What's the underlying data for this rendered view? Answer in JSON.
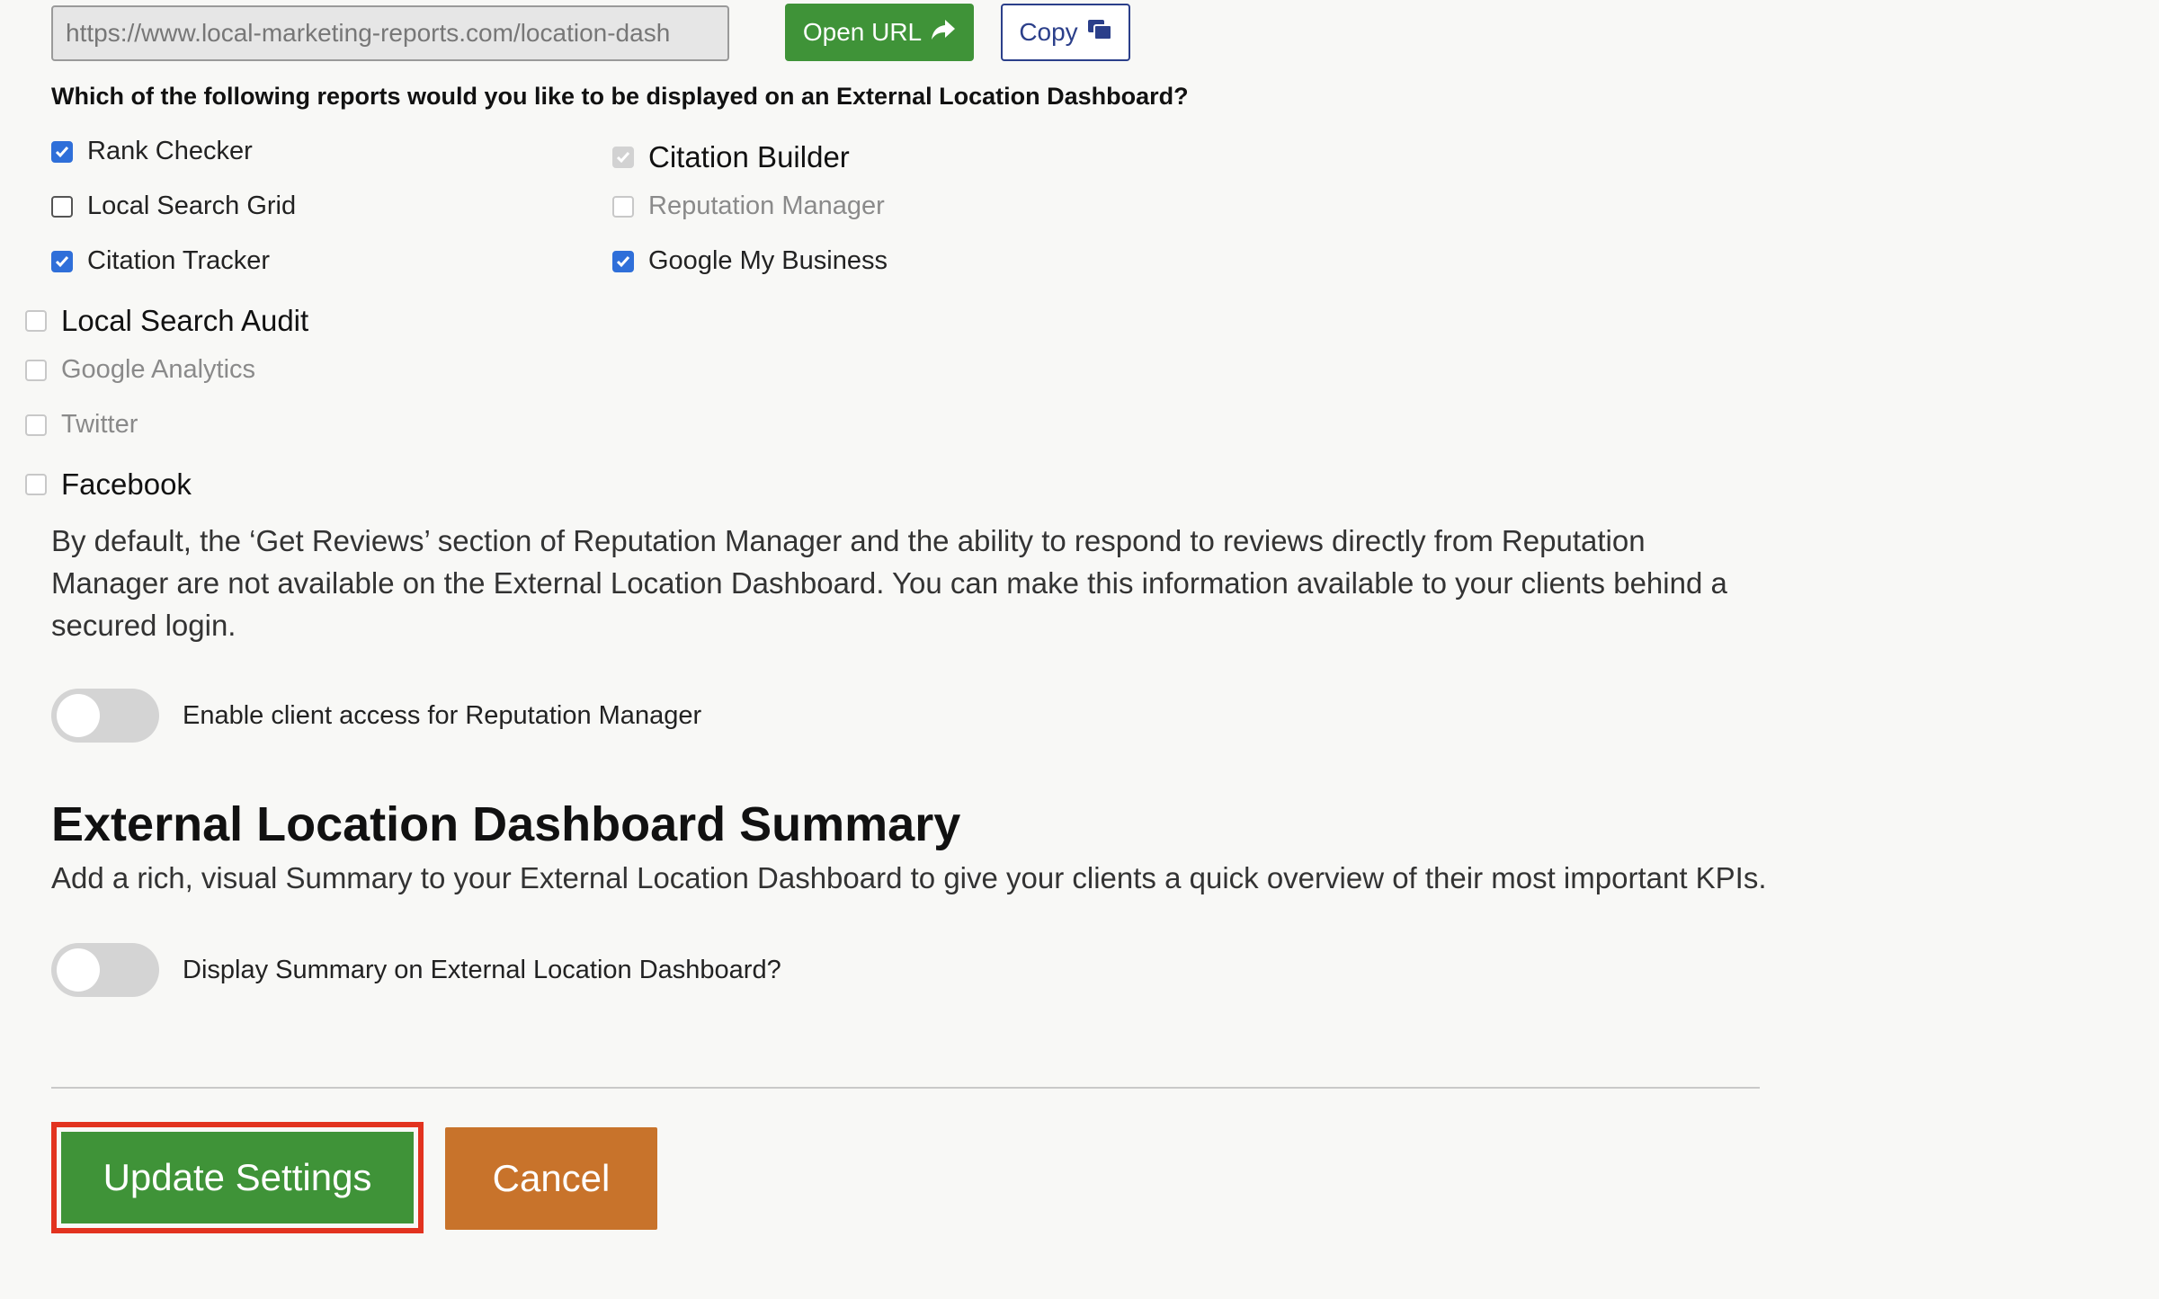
{
  "url_bar": {
    "value": "https://www.local-marketing-reports.com/location-dash",
    "open_label": "Open URL",
    "copy_label": "Copy"
  },
  "reports": {
    "question": "Which of the following reports would you like to be displayed on an External Location Dashboard?",
    "options": [
      {
        "label": "Rank Checker",
        "checked": true,
        "disabled": false
      },
      {
        "label": "Local Search Grid",
        "checked": false,
        "disabled": false
      },
      {
        "label": "Citation Tracker",
        "checked": true,
        "disabled": false
      },
      {
        "label": "Citation Builder",
        "checked": true,
        "disabled": true
      },
      {
        "label": "Reputation Manager",
        "checked": false,
        "disabled": true
      },
      {
        "label": "Google My Business",
        "checked": true,
        "disabled": false
      },
      {
        "label": "Local Search Audit",
        "checked": false,
        "disabled": false
      },
      {
        "label": "Google Analytics",
        "checked": false,
        "disabled": true
      },
      {
        "label": "Twitter",
        "checked": false,
        "disabled": true
      },
      {
        "label": "Facebook",
        "checked": false,
        "disabled": false
      }
    ]
  },
  "reputation_note": "By default, the ‘Get Reviews’ section of Reputation Manager and the ability to respond to reviews directly from Reputation Manager are not available on the External Location Dashboard. You can make this information available to your clients behind a secured login.",
  "toggles": {
    "client_access": {
      "label": "Enable client access for Reputation Manager",
      "on": false
    },
    "display_summary": {
      "label": "Display Summary on External Location Dashboard?",
      "on": false
    }
  },
  "summary": {
    "title": "External Location Dashboard Summary",
    "description": "Add a rich, visual Summary to your External Location Dashboard to give your clients a quick overview of their most important KPIs."
  },
  "actions": {
    "update_label": "Update Settings",
    "cancel_label": "Cancel"
  },
  "colors": {
    "primary_green": "#3f9338",
    "cancel_orange": "#c8732b",
    "checkbox_blue": "#2f6fd9",
    "highlight_red": "#e2331f",
    "copy_navy": "#2b3f8a"
  }
}
